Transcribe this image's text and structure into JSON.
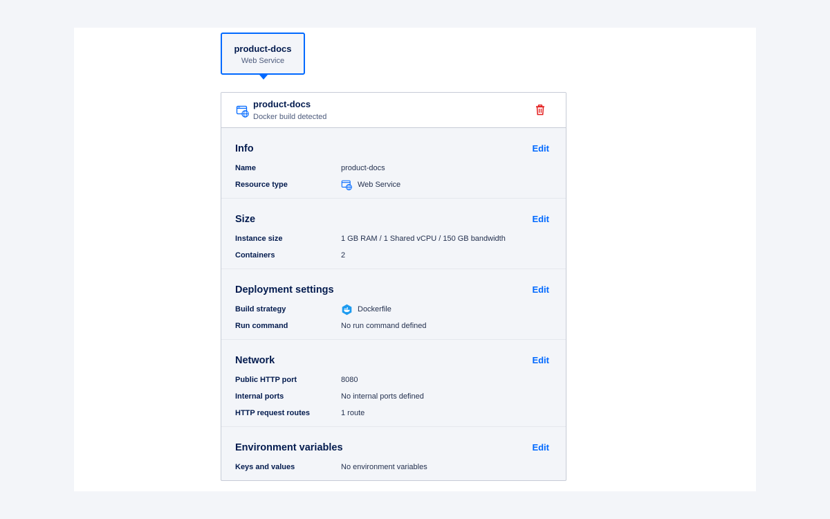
{
  "node": {
    "title": "product-docs",
    "subtitle": "Web Service"
  },
  "panel": {
    "title": "product-docs",
    "subtitle": "Docker build detected",
    "icon": "web-service-icon",
    "delete_icon": "trash-icon"
  },
  "colors": {
    "accent": "#0069ff",
    "danger": "#e31b1b",
    "text": "#031b4e",
    "panel_bg": "#f3f5f9"
  },
  "sections": {
    "info": {
      "title": "Info",
      "edit": "Edit",
      "rows": [
        {
          "label": "Name",
          "value": "product-docs"
        },
        {
          "label": "Resource type",
          "value": "Web Service",
          "icon": "web-service-icon"
        }
      ]
    },
    "size": {
      "title": "Size",
      "edit": "Edit",
      "rows": [
        {
          "label": "Instance size",
          "value": "1 GB RAM / 1 Shared vCPU / 150 GB bandwidth"
        },
        {
          "label": "Containers",
          "value": "2"
        }
      ]
    },
    "deployment": {
      "title": "Deployment settings",
      "edit": "Edit",
      "rows": [
        {
          "label": "Build strategy",
          "value": "Dockerfile",
          "icon": "docker-icon"
        },
        {
          "label": "Run command",
          "value": "No run command defined"
        }
      ]
    },
    "network": {
      "title": "Network",
      "edit": "Edit",
      "rows": [
        {
          "label": "Public HTTP port",
          "value": "8080"
        },
        {
          "label": "Internal ports",
          "value": "No internal ports defined"
        },
        {
          "label": "HTTP request routes",
          "value": "1 route"
        }
      ]
    },
    "env": {
      "title": "Environment variables",
      "edit": "Edit",
      "rows": [
        {
          "label": "Keys and values",
          "value": "No environment variables"
        }
      ]
    }
  }
}
